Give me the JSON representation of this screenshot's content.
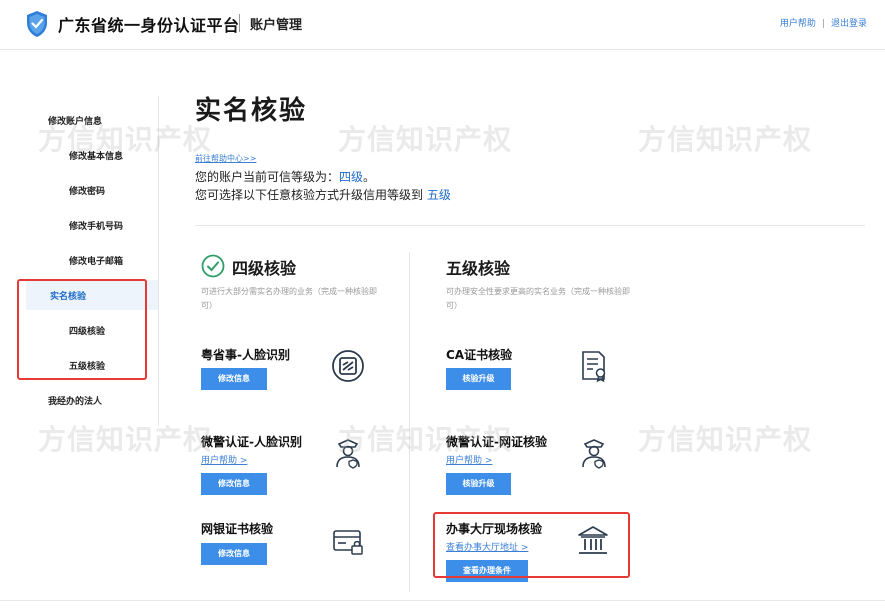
{
  "header": {
    "brand": "广东省统一身份认证平台",
    "section": "账户管理",
    "help_link": "用户帮助",
    "logout_link": "退出登录"
  },
  "sidebar": {
    "items": [
      {
        "label": "修改账户信息"
      },
      {
        "label": "修改基本信息"
      },
      {
        "label": "修改密码"
      },
      {
        "label": "修改手机号码"
      },
      {
        "label": "修改电子邮箱"
      },
      {
        "label": "实名核验"
      },
      {
        "label": "四级核验"
      },
      {
        "label": "五级核验"
      },
      {
        "label": "我经办的法人"
      }
    ]
  },
  "main": {
    "title": "实名核验",
    "help_center_link": "前往帮助中心>>",
    "level_prefix": "您的账户当前可信等级为：",
    "current_level": "四级",
    "level_suffix": "。",
    "upgrade_prefix": "您可选择以下任意核验方式升级信用等级到 ",
    "target_level": "五级"
  },
  "level4": {
    "title": "四级核验",
    "desc": "可进行大部分需实名办理的业务（完成一种核验即可）",
    "items": [
      {
        "title": "粤省事-人脸识别",
        "button": "修改信息",
        "icon": "yss-logo-icon"
      },
      {
        "title": "微警认证-人脸识别",
        "sub": "用户帮助 >",
        "button": "修改信息",
        "icon": "police-officer-icon"
      },
      {
        "title": "网银证书核验",
        "button": "修改信息",
        "icon": "bank-cert-icon"
      }
    ]
  },
  "level5": {
    "title": "五级核验",
    "desc": "可办理安全性要求更高的实名业务（完成一种核验即可）",
    "items": [
      {
        "title": "CA证书核验",
        "button": "核验升级",
        "icon": "certificate-icon"
      },
      {
        "title": "微警认证-网证核验",
        "sub": "用户帮助 >",
        "button": "核验升级",
        "icon": "police-officer-icon"
      },
      {
        "title": "办事大厅现场核验",
        "sub": "查看办事大厅地址 >",
        "button": "查看办理条件",
        "icon": "government-hall-icon"
      }
    ]
  },
  "watermark": "方信知识产权",
  "colors": {
    "accent": "#3d8ee8",
    "link": "#3a7fd5",
    "highlight_box": "#e53935",
    "check": "#2e9e6a"
  }
}
